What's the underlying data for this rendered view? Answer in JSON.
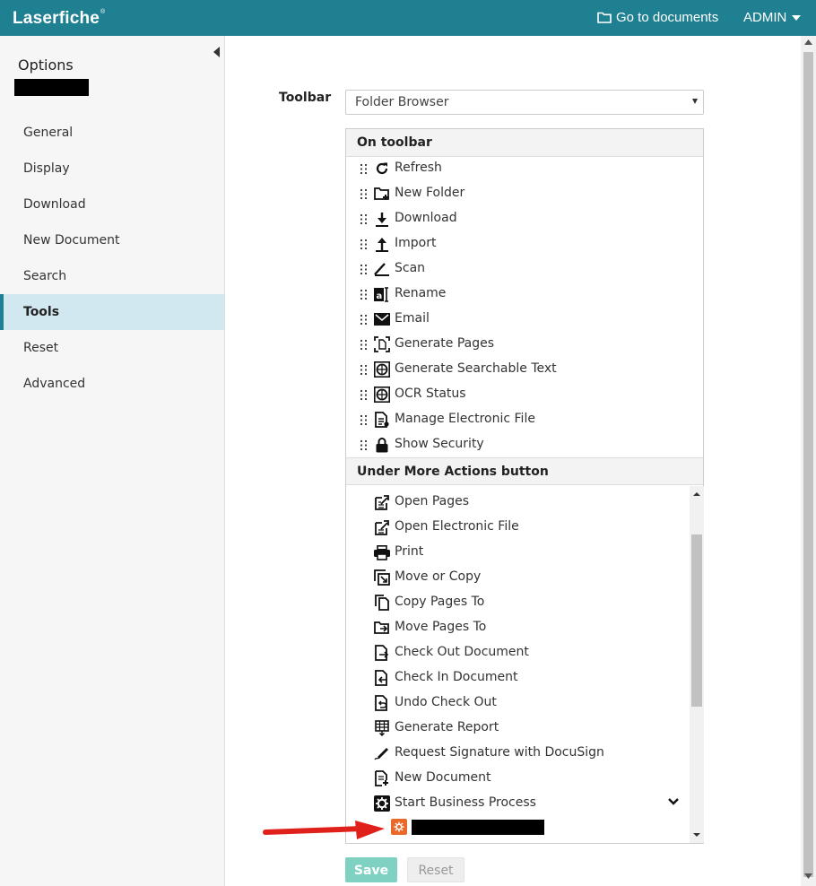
{
  "topbar": {
    "logo": "Laserfiche",
    "logo_mark": "®",
    "go_to_documents": "Go to documents",
    "user": "ADMIN"
  },
  "sidebar": {
    "title": "Options",
    "items": [
      {
        "label": "General"
      },
      {
        "label": "Display"
      },
      {
        "label": "Download"
      },
      {
        "label": "New Document"
      },
      {
        "label": "Search"
      },
      {
        "label": "Tools"
      },
      {
        "label": "Reset"
      },
      {
        "label": "Advanced"
      }
    ],
    "active": "Tools"
  },
  "main": {
    "toolbar_label": "Toolbar",
    "toolbar_select_value": "Folder Browser",
    "on_toolbar_heading": "On toolbar",
    "on_toolbar_items": [
      {
        "label": "Refresh",
        "icon": "refresh-icon"
      },
      {
        "label": "New Folder",
        "icon": "new-folder-icon"
      },
      {
        "label": "Download",
        "icon": "download-icon"
      },
      {
        "label": "Import",
        "icon": "import-icon"
      },
      {
        "label": "Scan",
        "icon": "scan-icon"
      },
      {
        "label": "Rename",
        "icon": "rename-icon"
      },
      {
        "label": "Email",
        "icon": "email-icon"
      },
      {
        "label": "Generate Pages",
        "icon": "generate-pages-icon"
      },
      {
        "label": "Generate Searchable Text",
        "icon": "ocr-icon"
      },
      {
        "label": "OCR Status",
        "icon": "ocr-status-icon"
      },
      {
        "label": "Manage Electronic File",
        "icon": "electronic-file-icon"
      },
      {
        "label": "Show Security",
        "icon": "lock-icon"
      }
    ],
    "more_actions_heading": "Under More Actions button",
    "more_actions_items": [
      {
        "label": "Open Pages",
        "icon": "open-pages-icon"
      },
      {
        "label": "Open Electronic File",
        "icon": "open-electronic-file-icon"
      },
      {
        "label": "Print",
        "icon": "print-icon"
      },
      {
        "label": "Move or Copy",
        "icon": "move-copy-icon"
      },
      {
        "label": "Copy Pages To",
        "icon": "copy-pages-icon"
      },
      {
        "label": "Move Pages To",
        "icon": "move-pages-icon"
      },
      {
        "label": "Check Out Document",
        "icon": "check-out-icon"
      },
      {
        "label": "Check In Document",
        "icon": "check-in-icon"
      },
      {
        "label": "Undo Check Out",
        "icon": "undo-check-out-icon"
      },
      {
        "label": "Generate Report",
        "icon": "report-icon"
      },
      {
        "label": "Request Signature with DocuSign",
        "icon": "signature-icon"
      },
      {
        "label": "New Document",
        "icon": "new-document-icon"
      },
      {
        "label": "Start Business Process",
        "icon": "gear-icon"
      }
    ],
    "custom_item_icon": "custom-gear-icon"
  },
  "buttons": {
    "save": "Save",
    "reset": "Reset"
  },
  "colors": {
    "brand": "#1e8091",
    "active_nav": "#d1e8f0",
    "save_button": "#7fd1c2",
    "custom_icon": "#e8692a",
    "arrow": "#e0201b"
  }
}
